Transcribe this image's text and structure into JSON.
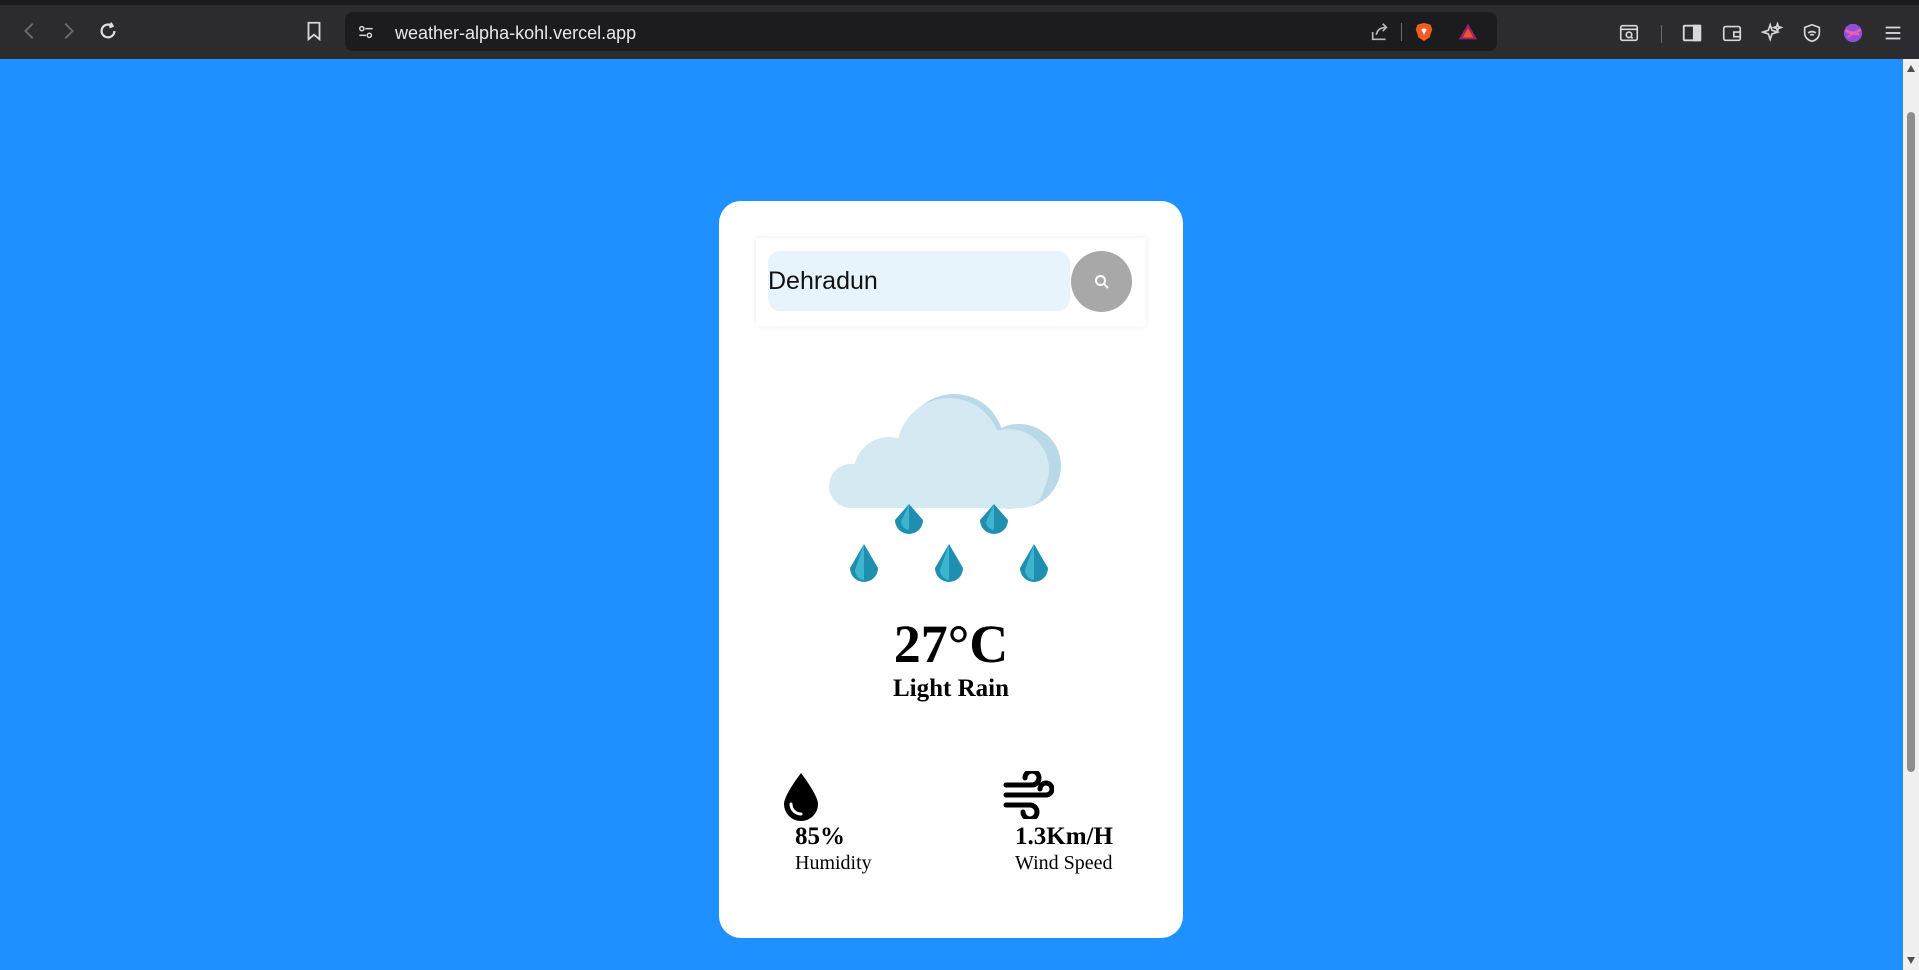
{
  "browser": {
    "url": "weather-alpha-kohl.vercel.app"
  },
  "search": {
    "value": "Dehradun"
  },
  "weather": {
    "icon": "rain-cloud-icon",
    "temperature": "27°C",
    "condition": "Light Rain"
  },
  "stats": {
    "humidity": {
      "value": "85%",
      "label": "Humidity",
      "icon": "humidity-drop-icon"
    },
    "wind": {
      "value": "1.3Km/H",
      "label": "Wind Speed",
      "icon": "wind-icon"
    }
  },
  "colors": {
    "background": "#1e90ff",
    "card": "#ffffff",
    "search_field": "#e8f4fb",
    "search_button": "#a8a8a8"
  }
}
